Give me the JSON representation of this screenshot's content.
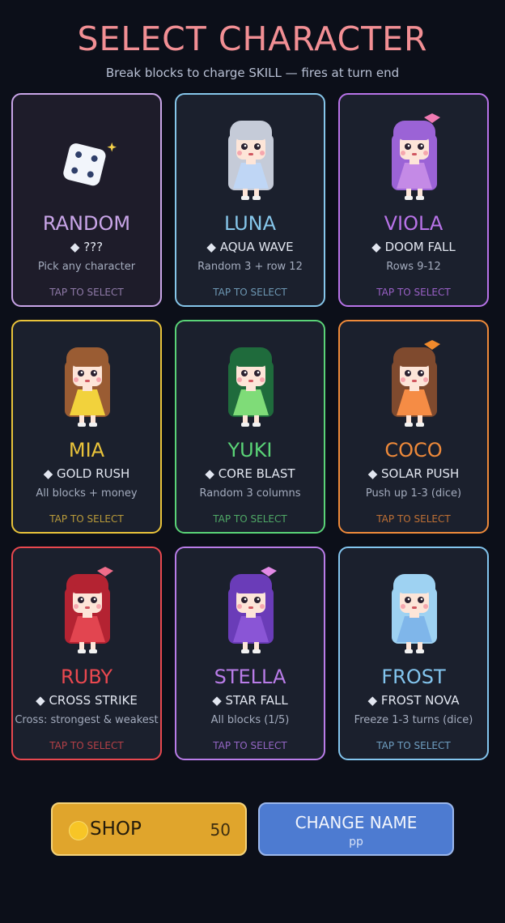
{
  "header": {
    "title": "SELECT CHARACTER",
    "subtitle": "Break blocks to charge SKILL — fires at turn end"
  },
  "characters": [
    {
      "id": "random",
      "name": "RANDOM",
      "skill": "◆ ???",
      "desc": "Pick any character",
      "tap": "TAP TO SELECT",
      "color": "#c9a5e8",
      "tap_color": "#8f7aa8",
      "icon": "dice-icon"
    },
    {
      "id": "luna",
      "name": "LUNA",
      "skill": "◆ AQUA WAVE",
      "desc": "Random 3 + row 12",
      "tap": "TAP TO SELECT",
      "color": "#86c6ea",
      "tap_color": "#6d97b3",
      "hair": "#c5cbd8",
      "dress": "#bfd6f5",
      "bow": ""
    },
    {
      "id": "viola",
      "name": "VIOLA",
      "skill": "◆ DOOM FALL",
      "desc": "Rows 9-12",
      "tap": "TAP TO SELECT",
      "color": "#b873e8",
      "tap_color": "#9960c6",
      "hair": "#9b63d6",
      "dress": "#c48ae6",
      "bow": "#f07ab2"
    },
    {
      "id": "mia",
      "name": "MIA",
      "skill": "◆ GOLD RUSH",
      "desc": "All blocks + money",
      "tap": "TAP TO SELECT",
      "color": "#e9c33a",
      "tap_color": "#b89a3a",
      "hair": "#9a5c33",
      "dress": "#f2d23c",
      "bow": ""
    },
    {
      "id": "yuki",
      "name": "YUKI",
      "skill": "◆ CORE BLAST",
      "desc": "Random 3 columns",
      "tap": "TAP TO SELECT",
      "color": "#5ad377",
      "tap_color": "#4fa866",
      "hair": "#1f6b3c",
      "dress": "#7fdc78",
      "bow": ""
    },
    {
      "id": "coco",
      "name": "COCO",
      "skill": "◆ SOLAR PUSH",
      "desc": "Push up 1-3 (dice)",
      "tap": "TAP TO SELECT",
      "color": "#ef8a3a",
      "tap_color": "#bf7035",
      "hair": "#7f4a2e",
      "dress": "#f58c45",
      "bow": "#f08a2c"
    },
    {
      "id": "ruby",
      "name": "RUBY",
      "skill": "◆ CROSS STRIKE",
      "desc": "Cross: strongest & weakest",
      "tap": "TAP TO SELECT",
      "color": "#e9484f",
      "tap_color": "#b44047",
      "hair": "#b42332",
      "dress": "#e24550",
      "bow": "#f06d8a"
    },
    {
      "id": "stella",
      "name": "STELLA",
      "skill": "◆ STAR FALL",
      "desc": "All blocks (1/5)",
      "tap": "TAP TO SELECT",
      "color": "#b97ce8",
      "tap_color": "#9466c4",
      "hair": "#6a3cb8",
      "dress": "#8a55d6",
      "bow": "#e28ae6"
    },
    {
      "id": "frost",
      "name": "FROST",
      "skill": "◆ FROST NOVA",
      "desc": "Freeze 1-3 turns (dice)",
      "tap": "TAP TO SELECT",
      "color": "#83c5ee",
      "tap_color": "#6f9fc2",
      "hair": "#9ed2f2",
      "dress": "#7fb6ea",
      "bow": ""
    }
  ],
  "footer": {
    "shop_label": "SHOP",
    "coins": "50",
    "change_name_label": "CHANGE NAME",
    "player_name": "pp",
    "shop_color": "#e0a52c",
    "change_name_color": "#4d7bd1"
  }
}
